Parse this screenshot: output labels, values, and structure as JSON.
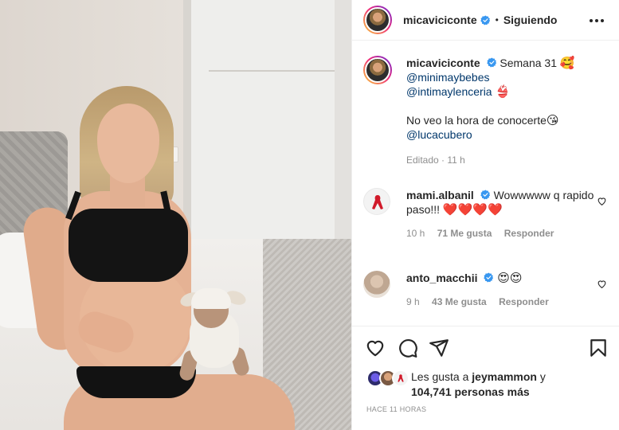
{
  "colors": {
    "accent_blue": "#3897f0",
    "mention": "#00376b",
    "muted": "#8e8e8e",
    "text": "#262626"
  },
  "header": {
    "username": "micaviciconte",
    "separator": "•",
    "follow_status": "Siguiendo",
    "icons": {
      "verified": "verified-badge-icon",
      "more": "more-options-icon"
    }
  },
  "caption": {
    "username": "micaviciconte",
    "text": "Semana 31",
    "emoji1": "🥰",
    "mention1": "@minimaybebes",
    "mention2": "@intimaylenceria",
    "emoji2": "👙",
    "line2": "No veo la hora de conocerte",
    "emoji3": "😘",
    "mention3": "@lucacubero",
    "edited": "Editado · 11 h"
  },
  "comments": [
    {
      "username": "mami.albanil",
      "text": "Wowwwww q rapido paso!!!",
      "emoji": "❤️❤️❤️❤️",
      "time": "10 h",
      "likes": "71 Me gusta",
      "reply": "Responder"
    },
    {
      "username": "anto_macchii",
      "text": "",
      "emoji": "😍😍",
      "time": "9 h",
      "likes": "43 Me gusta",
      "reply": "Responder"
    }
  ],
  "actions": {
    "icons": [
      "like-heart-icon",
      "comment-icon",
      "share-icon",
      "save-bookmark-icon"
    ]
  },
  "likes": {
    "prefix": "Les gusta a",
    "user": "jeymammon",
    "conj": "y",
    "count": "104,741 personas más"
  },
  "post_time": "HACE 11 HORAS"
}
